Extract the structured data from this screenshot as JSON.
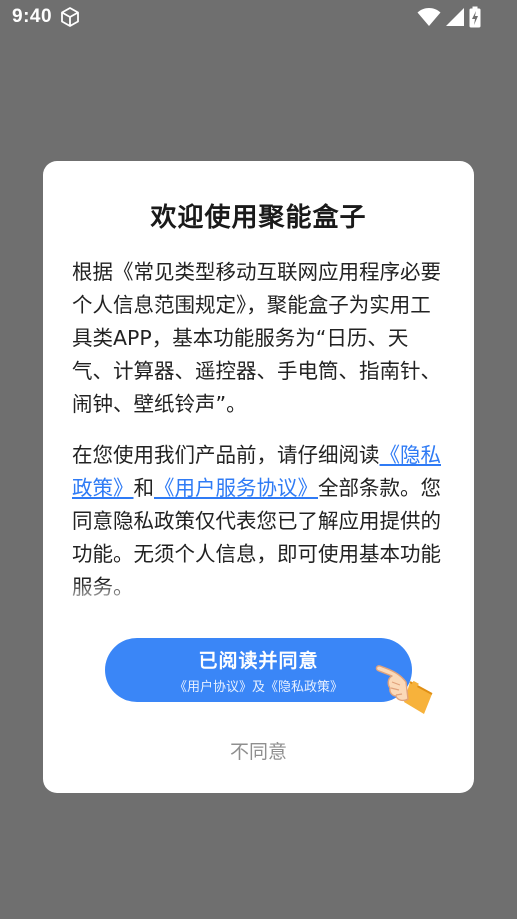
{
  "status_bar": {
    "time": "9:40",
    "icons": [
      "cube-icon",
      "wifi-icon",
      "signal-icon",
      "battery-charging-icon"
    ]
  },
  "dialog": {
    "title": "欢迎使用聚能盒子",
    "paragraph1": "根据《常见类型移动互联网应用程序必要个人信息范围规定》，聚能盒子为实用工具类APP，基本功能服务为“日历、天气、计算器、遥控器、手电筒、指南针、闹钟、壁纸铃声”。",
    "paragraph2_prefix": "在您使用我们产品前，请仔细阅读",
    "privacy_link": "《隐私政策》",
    "and_text": "和",
    "user_agreement_link": "《用户服务协议》",
    "paragraph2_suffix": "全部条款。您同意隐私政策仅代表您已了解应用提供的功能。无须个人信息，即可使用基本功能服务。",
    "agree_label": "已阅读并同意",
    "agree_sublabel": "《用户协议》及《隐私政策》",
    "disagree_label": "不同意"
  },
  "colors": {
    "overlay": "#6f6f6f",
    "accent": "#3a86f7",
    "link": "#2f7bf5"
  }
}
